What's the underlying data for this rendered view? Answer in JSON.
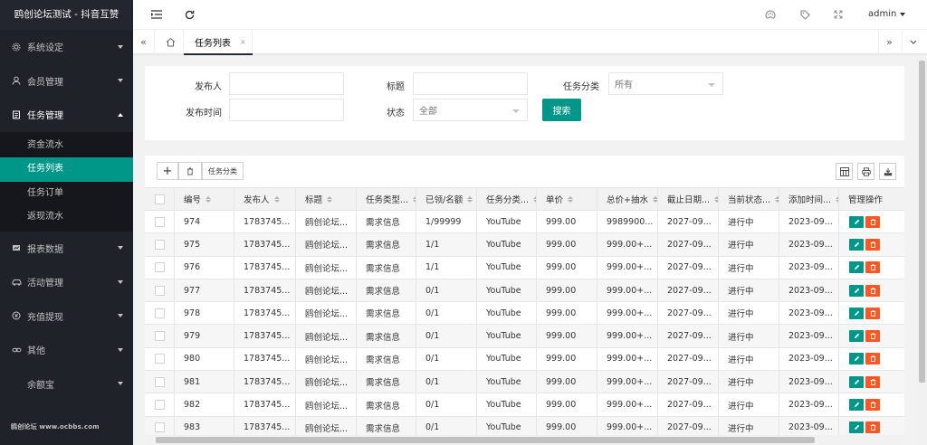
{
  "app": {
    "title": "鸥创论坛测试 - 抖音互赞",
    "footer_watermark": "鸥创论坛 www.ocbbs.com"
  },
  "sidebar": {
    "items": [
      {
        "label": "系统设定",
        "icon": "gear-icon",
        "expanded": false
      },
      {
        "label": "会员管理",
        "icon": "user-icon",
        "expanded": false
      },
      {
        "label": "任务管理",
        "icon": "document-icon",
        "expanded": true
      },
      {
        "label": "报表数据",
        "icon": "chart-icon",
        "expanded": false
      },
      {
        "label": "活动管理",
        "icon": "car-icon",
        "expanded": false
      },
      {
        "label": "充值提现",
        "icon": "coin-icon",
        "expanded": false
      },
      {
        "label": "其他",
        "icon": "link-icon",
        "expanded": false
      },
      {
        "label": "余额宝",
        "icon": "",
        "expanded": false
      }
    ],
    "task_subitems": [
      {
        "label": "资金流水",
        "active": false
      },
      {
        "label": "任务列表",
        "active": true
      },
      {
        "label": "任务订单",
        "active": false
      },
      {
        "label": "返现流水",
        "active": false
      }
    ]
  },
  "header": {
    "user": "admin",
    "icons": [
      "menu-fold-icon",
      "refresh-icon",
      "theme-icon",
      "tag-icon",
      "fullscreen-icon"
    ]
  },
  "tabs": {
    "active_label": "任务列表",
    "close_glyph": "×"
  },
  "search": {
    "publisher_label": "发布人",
    "publisher_value": "",
    "title_label": "标题",
    "title_value": "",
    "category_label": "任务分类",
    "category_value": "所有",
    "time_label": "发布时间",
    "time_value": "",
    "status_label": "状态",
    "status_value": "全部",
    "search_button": "搜索"
  },
  "toolbar": {
    "add_glyph": "+",
    "category_button": "任务分类"
  },
  "table": {
    "columns": [
      "编号",
      "发布人",
      "标题",
      "任务类型...",
      "已领/名额",
      "任务分类...",
      "单价",
      "总价+抽水",
      "截止日期...",
      "当前状态...",
      "添加时间...",
      "管理操作"
    ],
    "rows": [
      [
        "974",
        "1783745...",
        "鸥创论坛...",
        "需求信息",
        "1/99999",
        "YouTube",
        "999.00",
        "9989900...",
        "2027-09...",
        "进行中",
        "2023-09..."
      ],
      [
        "975",
        "1783745...",
        "鸥创论坛...",
        "需求信息",
        "1/1",
        "YouTube",
        "999.00",
        "999.00+...",
        "2027-09...",
        "进行中",
        "2023-09..."
      ],
      [
        "976",
        "1783745...",
        "鸥创论坛...",
        "需求信息",
        "1/1",
        "YouTube",
        "999.00",
        "999.00+...",
        "2027-09...",
        "进行中",
        "2023-09..."
      ],
      [
        "977",
        "1783745...",
        "鸥创论坛...",
        "需求信息",
        "0/1",
        "YouTube",
        "999.00",
        "999.00+...",
        "2027-09...",
        "进行中",
        "2023-09..."
      ],
      [
        "978",
        "1783745...",
        "鸥创论坛...",
        "需求信息",
        "0/1",
        "YouTube",
        "999.00",
        "999.00+...",
        "2027-09...",
        "进行中",
        "2023-09..."
      ],
      [
        "979",
        "1783745...",
        "鸥创论坛...",
        "需求信息",
        "0/1",
        "YouTube",
        "999.00",
        "999.00+...",
        "2027-09...",
        "进行中",
        "2023-09..."
      ],
      [
        "980",
        "1783745...",
        "鸥创论坛...",
        "需求信息",
        "0/1",
        "YouTube",
        "999.00",
        "999.00+...",
        "2027-09...",
        "进行中",
        "2023-09..."
      ],
      [
        "981",
        "1783745...",
        "鸥创论坛...",
        "需求信息",
        "0/1",
        "YouTube",
        "999.00",
        "999.00+...",
        "2027-09...",
        "进行中",
        "2023-09..."
      ],
      [
        "982",
        "1783745...",
        "鸥创论坛...",
        "需求信息",
        "0/1",
        "YouTube",
        "999.00",
        "999.00+...",
        "2027-09...",
        "进行中",
        "2023-09..."
      ],
      [
        "983",
        "1783745...",
        "鸥创论坛...",
        "需求信息",
        "0/1",
        "YouTube",
        "999.00",
        "999.00+...",
        "2027-09...",
        "进行中",
        "2023-09..."
      ]
    ]
  },
  "colors": {
    "accent": "#009688",
    "danger": "#ff5722",
    "sidebar_bg": "#20222a"
  }
}
